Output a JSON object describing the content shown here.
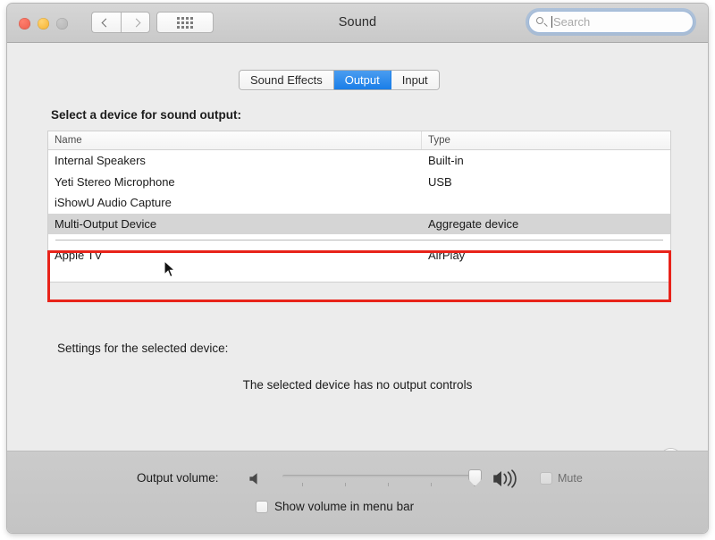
{
  "window": {
    "title": "Sound",
    "traffic_lights": [
      "close-red",
      "minimize-yellow",
      "maximize-gray"
    ],
    "back_label": "‹",
    "forward_label": "›",
    "grid_icon": "grid-view-icon",
    "colors": {
      "titlebar": "#cdcdcd",
      "content_bg": "#ececec",
      "bottom_bar": "#c8c8c8",
      "tab_active": "#1a7ee8",
      "annotation_red": "#e8231a",
      "help_blue": "#39609e",
      "row_selected": "#d5d5d5"
    }
  },
  "search": {
    "value": "",
    "placeholder": "Search",
    "icon": "search-icon",
    "focused": true
  },
  "tabs": [
    {
      "label": "Sound Effects",
      "active": false
    },
    {
      "label": "Output",
      "active": true
    },
    {
      "label": "Input",
      "active": false
    }
  ],
  "main": {
    "section_label": "Select a device for sound output:",
    "table": {
      "columns": [
        "Name",
        "Type"
      ],
      "rows": [
        {
          "name": "Internal Speakers",
          "type": "Built-in",
          "selected": false
        },
        {
          "name": "Yeti Stereo Microphone",
          "type": "USB",
          "selected": false
        },
        {
          "name": "iShowU Audio Capture",
          "type": "",
          "selected": false
        },
        {
          "name": "Multi-Output Device",
          "type": "Aggregate device",
          "selected": true
        },
        {
          "name": "Apple TV",
          "type": "AirPlay",
          "selected": false
        }
      ]
    },
    "settings_label": "Settings for the selected device:",
    "no_controls_text": "The selected device has no output controls",
    "help_label": "?"
  },
  "bottom": {
    "volume_label": "Output volume:",
    "speaker_low_icon": "speaker-mute-icon",
    "speaker_high_icon": "speaker-loud-icon",
    "slider_value_percent": 94,
    "mute_label": "Mute",
    "mute_checked": false,
    "mute_disabled": true,
    "show_volume_label": "Show volume in menu bar",
    "show_volume_checked": false
  }
}
